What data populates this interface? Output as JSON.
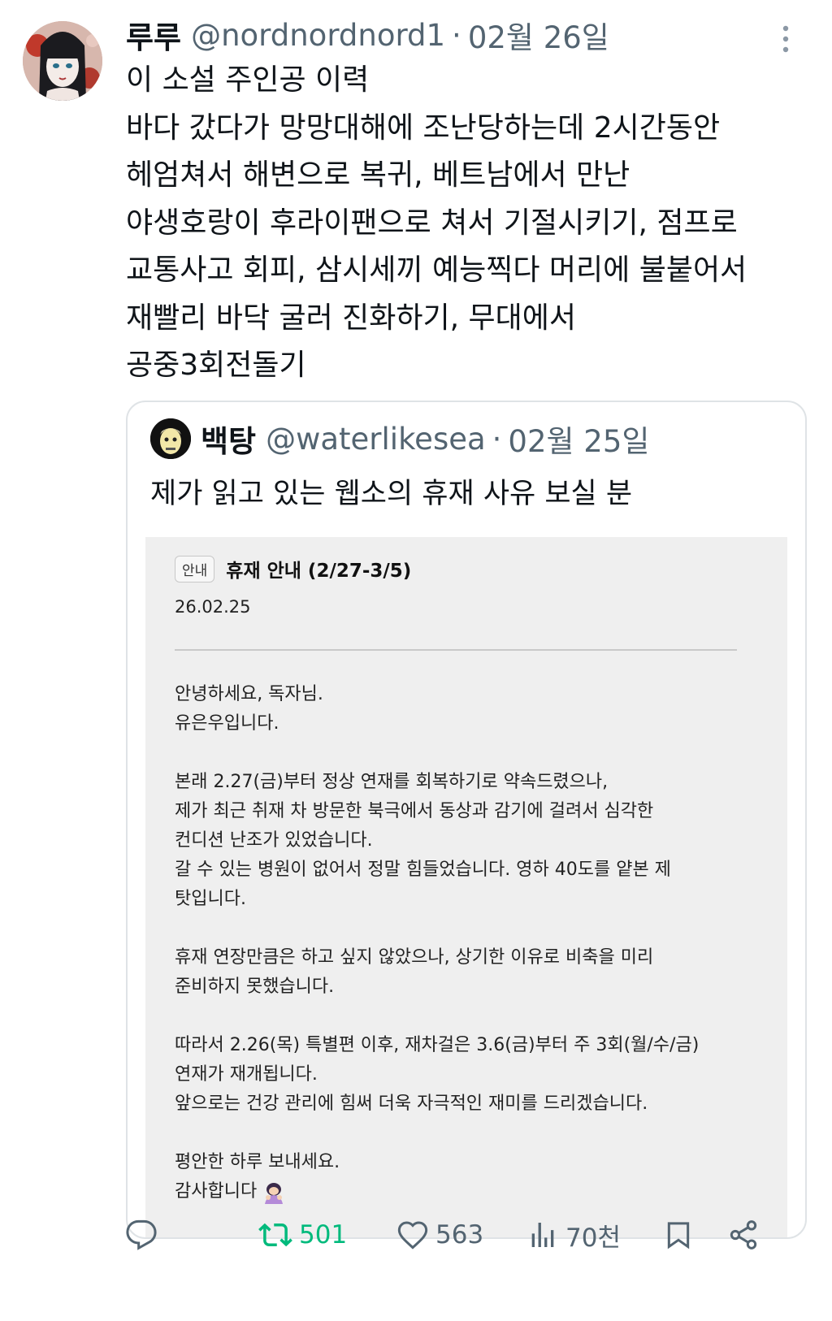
{
  "tweet": {
    "author_name": "루루",
    "handle": "@nordnordnord1",
    "separator": "·",
    "date": "02월 26일",
    "text_lines": [
      "이 소설 주인공 이력",
      "바다 갔다가 망망대해에 조난당하는데 2시간동안",
      "헤엄쳐서 해변으로 복귀, 베트남에서 만난",
      "야생호랑이 후라이팬으로 쳐서 기절시키기, 점프로",
      "교통사고 회피, 삼시세끼 예능찍다 머리에 불붙어서",
      "재빨리 바닥 굴러 진화하기, 무대에서",
      "공중3회전돌기"
    ]
  },
  "quote": {
    "author_name": "백탕",
    "handle": "@waterlikesea",
    "separator": "·",
    "date": "02월 25일",
    "text": "제가 읽고 있는 웹소의 휴재 사유 보실 분"
  },
  "notice": {
    "badge": "안내",
    "title": "휴재 안내 (2/27-3/5)",
    "date": "26.02.25",
    "body_lines": [
      "안녕하세요, 독자님.",
      "유은우입니다.",
      "",
      "본래 2.27(금)부터 정상 연재를 회복하기로 약속드렸으나,",
      "제가 최근 취재 차 방문한 북극에서 동상과 감기에 걸려서 심각한",
      "컨디션 난조가 있었습니다.",
      "갈 수 있는 병원이 없어서 정말 힘들었습니다. 영하 40도를 얕본 제",
      "탓입니다.",
      "",
      "휴재 연장만큼은 하고 싶지 않았으나, 상기한 이유로 비축을 미리",
      "준비하지 못했습니다.",
      "",
      "따라서 2.26(목) 특별편 이후, 재차걸은 3.6(금)부터 주 3회(월/수/금)",
      "연재가 재개됩니다.",
      "앞으로는 건강 관리에 힘써 더욱 자극적인 재미를 드리겠습니다.",
      "",
      "평안한 하루 보내세요."
    ],
    "closing": "감사합니다",
    "closing_emoji": "bowing-person-emoji"
  },
  "actions": {
    "reply_icon": "reply-icon",
    "retweet_count": "501",
    "like_count": "563",
    "views_count": "70천",
    "bookmark_icon": "bookmark-icon",
    "share_icon": "share-icon"
  },
  "colors": {
    "text": "#0f1419",
    "secondary": "#536471",
    "retweet": "#00ba7c",
    "notice_bg": "#efefef",
    "border": "#dfe3e6"
  }
}
